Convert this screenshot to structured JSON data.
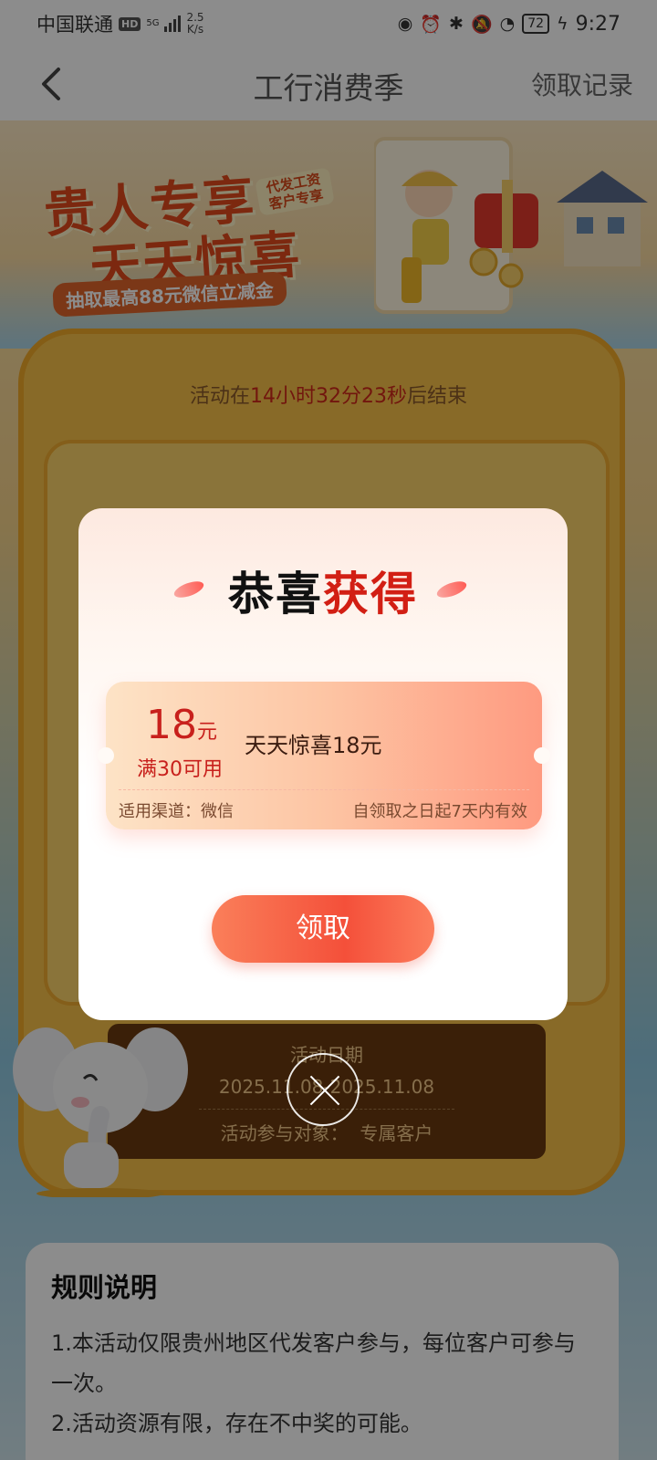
{
  "status_bar": {
    "carrier": "中国联通",
    "hd": "HD",
    "network_type": "5G",
    "net_speed_value": "2.5",
    "net_speed_unit": "K/s",
    "battery": "72",
    "time": "9:27"
  },
  "nav": {
    "title": "工行消费季",
    "record_label": "领取记录"
  },
  "banner": {
    "title_line1": "贵人专享",
    "title_line2": "天天惊喜",
    "tag": "代发工资 客户专享",
    "subtitle": "抽取最高88元微信立减金"
  },
  "activity": {
    "countdown_prefix": "活动在",
    "countdown_time": "14小时32分23秒",
    "countdown_suffix": "后结束",
    "date_label": "活动日期",
    "date_range": "2025.11.08-2025.11.08",
    "target_label": "活动参与对象：",
    "target_value": "专属客户"
  },
  "rules": {
    "title": "规则说明",
    "item1": "1.本活动仅限贵州地区代发客户参与，每位客户可参与一次。",
    "item2": "2.活动资源有限，存在不中奖的可能。"
  },
  "modal": {
    "title_black": "恭喜",
    "title_red": "获得",
    "coupon": {
      "amount": "18",
      "unit": "元",
      "condition": "满30可用",
      "name": "天天惊喜18元",
      "channel": "适用渠道：微信",
      "validity": "自领取之日起7天内有效"
    },
    "claim_label": "领取"
  },
  "colors": {
    "accent_red": "#d21f14",
    "claim_button": "#f4503a",
    "coupon_gradient_end": "#fe9a80"
  }
}
